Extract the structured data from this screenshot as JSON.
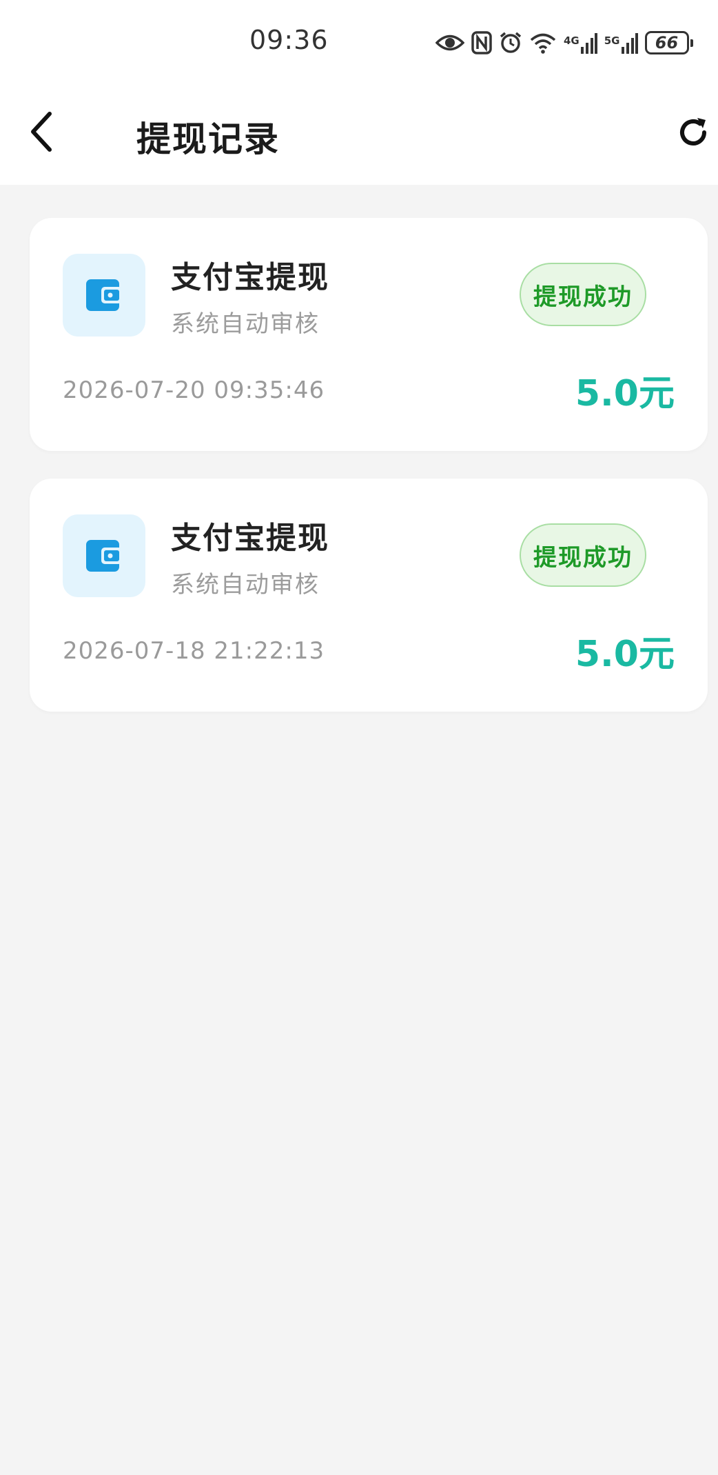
{
  "status_bar": {
    "time": "09:36",
    "net1": "4G",
    "net2": "5G",
    "battery": "66",
    "icons": [
      "eye-icon",
      "nfc-icon",
      "alarm-icon",
      "wifi-icon",
      "signal-4g-icon",
      "signal-5g-icon",
      "battery-icon"
    ]
  },
  "header": {
    "title": "提现记录",
    "back_icon": "chevron-left-icon",
    "refresh_icon": "refresh-icon"
  },
  "records": [
    {
      "icon": "wallet-icon",
      "title": "支付宝提现",
      "subtitle": "系统自动审核",
      "status": "提现成功",
      "time": "2026-07-20 09:35:46",
      "amount": "5.0元"
    },
    {
      "icon": "wallet-icon",
      "title": "支付宝提现",
      "subtitle": "系统自动审核",
      "status": "提现成功",
      "time": "2026-07-18 21:22:13",
      "amount": "5.0元"
    }
  ],
  "colors": {
    "accent": "#1ab9a2",
    "icon_blue": "#1b9be0",
    "status_green": "#1e9a28",
    "background": "#f4f4f4"
  }
}
